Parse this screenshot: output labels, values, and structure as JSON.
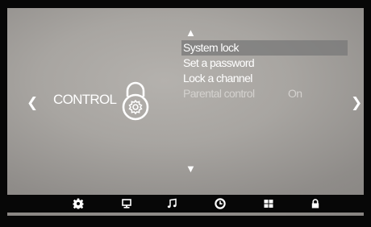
{
  "navigation": {
    "left_glyph": "❮",
    "right_glyph": "❯",
    "up_glyph": "▲",
    "down_glyph": "▼"
  },
  "category": {
    "label": "CONTROL",
    "icon": "lock-gear-icon"
  },
  "menu": {
    "items": [
      {
        "label": "System lock",
        "value": "",
        "state": "selected"
      },
      {
        "label": "Set a password",
        "value": "",
        "state": "normal"
      },
      {
        "label": "Lock a channel",
        "value": "",
        "state": "normal"
      },
      {
        "label": "Parental control",
        "value": "On",
        "state": "disabled"
      }
    ]
  },
  "bottom_bar": {
    "icons": [
      "settings-icon",
      "display-icon",
      "music-icon",
      "clock-icon",
      "apps-icon",
      "lock-icon"
    ],
    "active_index": 5
  },
  "colors": {
    "panel_background": "#a8a5a1",
    "selection_highlight": "#787878",
    "disabled_text": "#d4d2cf",
    "bar_background": "#070707",
    "text": "#ffffff"
  }
}
